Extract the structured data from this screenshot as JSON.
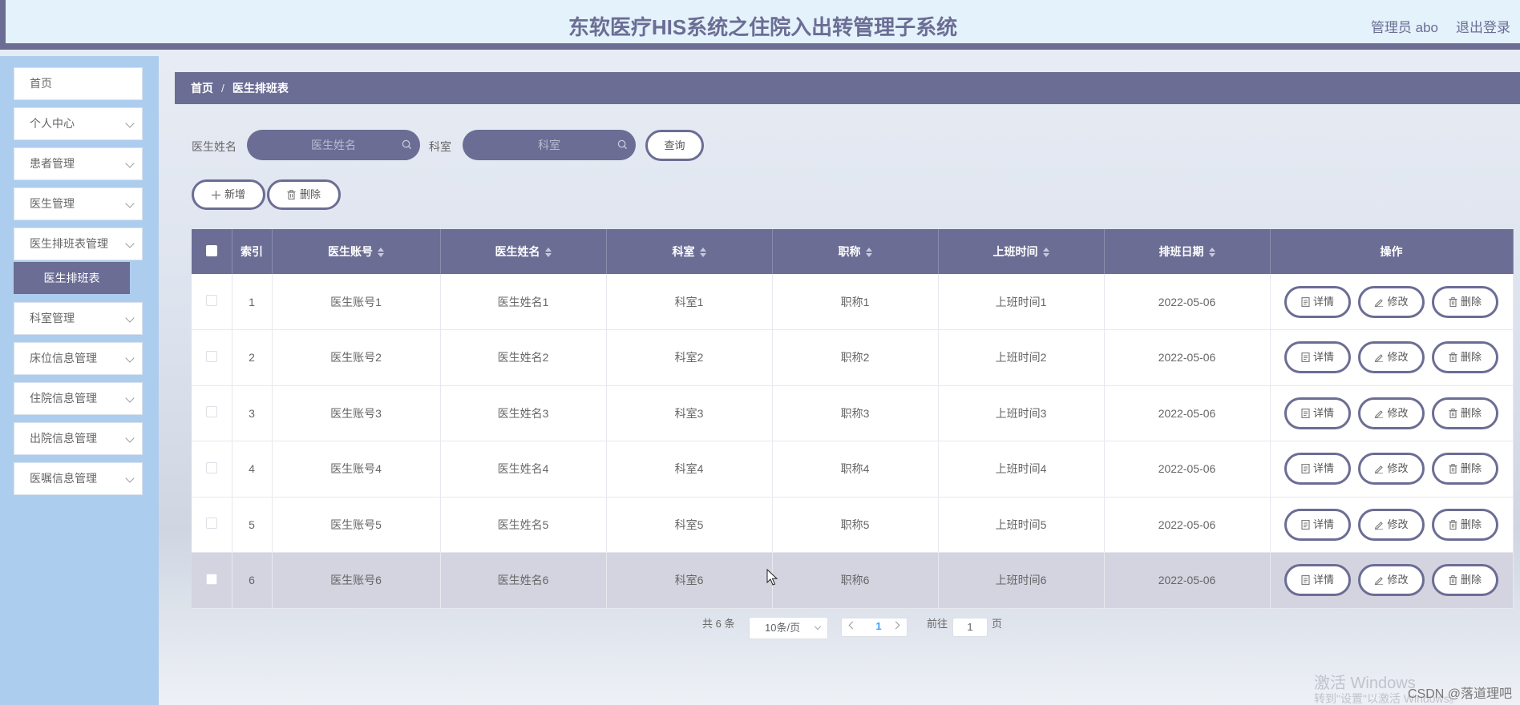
{
  "header": {
    "title": "东软医疗HIS系统之住院入出转管理子系统",
    "user": "管理员 abo",
    "logout": "退出登录"
  },
  "sidebar": {
    "items": [
      {
        "label": "首页",
        "has_arrow": false
      },
      {
        "label": "个人中心",
        "has_arrow": true
      },
      {
        "label": "患者管理",
        "has_arrow": true
      },
      {
        "label": "医生管理",
        "has_arrow": true
      },
      {
        "label": "医生排班表管理",
        "has_arrow": true
      }
    ],
    "active_sub": "医生排班表",
    "items_after": [
      {
        "label": "科室管理"
      },
      {
        "label": "床位信息管理"
      },
      {
        "label": "住院信息管理"
      },
      {
        "label": "出院信息管理"
      },
      {
        "label": "医嘱信息管理"
      }
    ]
  },
  "breadcrumb": {
    "home": "首页",
    "separator": "/",
    "current": "医生排班表"
  },
  "search": {
    "doctor_label": "医生姓名",
    "doctor_placeholder": "医生姓名",
    "dept_label": "科室",
    "dept_placeholder": "科室",
    "query_button": "查询"
  },
  "actions": {
    "add": "新增",
    "delete": "删除"
  },
  "table": {
    "headers": [
      "索引",
      "医生账号",
      "医生姓名",
      "科室",
      "职称",
      "上班时间",
      "排班日期",
      "操作"
    ],
    "rows": [
      {
        "index": "1",
        "account": "医生账号1",
        "name": "医生姓名1",
        "dept": "科室1",
        "title": "职称1",
        "time": "上班时间1",
        "date": "2022-05-06"
      },
      {
        "index": "2",
        "account": "医生账号2",
        "name": "医生姓名2",
        "dept": "科室2",
        "title": "职称2",
        "time": "上班时间2",
        "date": "2022-05-06"
      },
      {
        "index": "3",
        "account": "医生账号3",
        "name": "医生姓名3",
        "dept": "科室3",
        "title": "职称3",
        "time": "上班时间3",
        "date": "2022-05-06"
      },
      {
        "index": "4",
        "account": "医生账号4",
        "name": "医生姓名4",
        "dept": "科室4",
        "title": "职称4",
        "time": "上班时间4",
        "date": "2022-05-06"
      },
      {
        "index": "5",
        "account": "医生账号5",
        "name": "医生姓名5",
        "dept": "科室5",
        "title": "职称5",
        "time": "上班时间5",
        "date": "2022-05-06"
      },
      {
        "index": "6",
        "account": "医生账号6",
        "name": "医生姓名6",
        "dept": "科室6",
        "title": "职称6",
        "time": "上班时间6",
        "date": "2022-05-06"
      }
    ],
    "row_actions": {
      "detail": "详情",
      "edit": "修改",
      "delete": "删除"
    }
  },
  "pagination": {
    "total": "共 6 条",
    "page_size": "10条/页",
    "current_page": "1",
    "goto_label": "前往",
    "goto_value": "1",
    "page_suffix": "页"
  },
  "watermark": {
    "line1": "激活 Windows",
    "line2": "转到\"设置\"以激活 Windows。",
    "credit": "CSDN @落道理吧"
  },
  "colors": {
    "primary": "#6b6d94",
    "sidebar_bg": "#adcdee",
    "header_bg": "#e4f2fb",
    "link": "#409eff"
  }
}
